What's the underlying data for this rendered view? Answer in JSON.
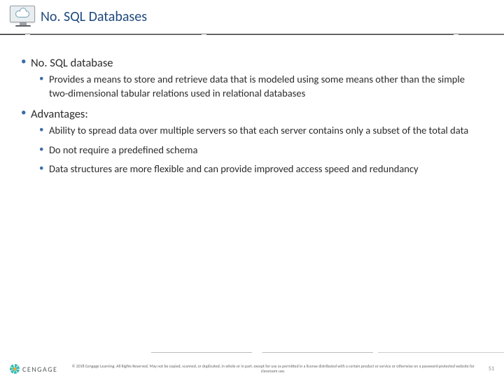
{
  "header": {
    "title": "No. SQL Databases"
  },
  "content": {
    "items": [
      {
        "label": "No. SQL database",
        "sub": [
          "Provides a means to store and retrieve data that is modeled using some means other than the simple two-dimensional tabular relations used in relational databases"
        ]
      },
      {
        "label": "Advantages:",
        "sub": [
          "Ability to spread data over multiple servers so that each server contains only a subset of the total data",
          "Do not require a predefined schema",
          "Data structures are more flexible and can provide improved access speed and redundancy"
        ]
      }
    ]
  },
  "footer": {
    "brand": "CENGAGE",
    "copyright": "© 2018 Cengage Learning. All Rights Reserved. May not be copied, scanned, or duplicated, in whole or in part, except for use as permitted in a license distributed with a certain product or service or otherwise on a password-protected website for classroom use.",
    "page": "51"
  }
}
